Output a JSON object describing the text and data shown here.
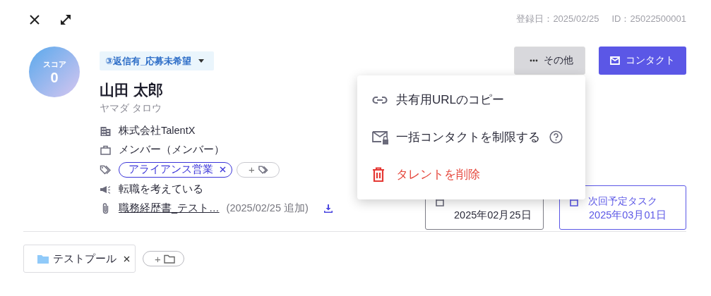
{
  "header": {
    "registered": "登録日：2025/02/25",
    "id": "ID：25022500001"
  },
  "score": {
    "label": "スコア",
    "value": "0"
  },
  "status": {
    "label": "③返信有_応募未希望"
  },
  "name": "山田 太郎",
  "kana": "ヤマダ タロウ",
  "info": [
    {
      "kind": "company",
      "text": "株式会社TalentX"
    },
    {
      "kind": "position",
      "text": "メンバー（メンバー）"
    },
    {
      "kind": "tags",
      "tags": [
        {
          "label": "アライアンス営業"
        }
      ],
      "add": "+"
    },
    {
      "kind": "intent",
      "text": "転職を考えている"
    },
    {
      "kind": "file",
      "name": "職務経歴書_テスト…",
      "added": "(2025/02/25 追加)"
    }
  ],
  "buttons": [
    {
      "kind": "more",
      "label": "その他",
      "open": true
    },
    {
      "kind": "contact",
      "label": "コンタクト"
    }
  ],
  "menu": {
    "items": [
      {
        "kind": "link",
        "label": "共有用URLのコピー"
      },
      {
        "kind": "restrict",
        "label": "一括コンタクトを制限する"
      },
      {
        "kind": "delete",
        "label": "タレントを削除"
      }
    ]
  },
  "cards": [
    {
      "kind": "last_contact",
      "date": "2025年02月25日"
    },
    {
      "kind": "next_task",
      "label": "次回予定タスク",
      "date": "2025年03月01日"
    }
  ],
  "pools": [
    {
      "label": "テストプール"
    }
  ],
  "pool_add": "+"
}
